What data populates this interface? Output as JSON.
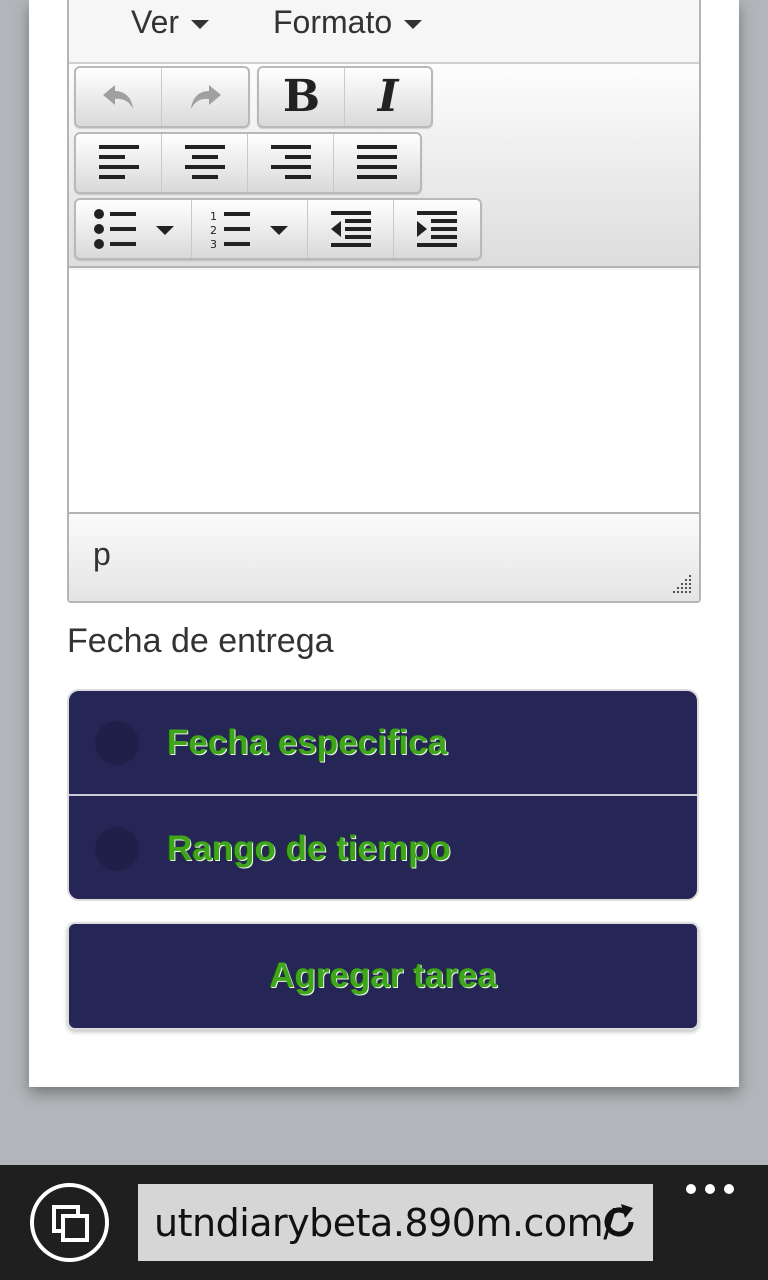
{
  "menubar": {
    "view_label": "Ver",
    "format_label": "Formato"
  },
  "toolbar": {
    "bold_glyph": "B",
    "italic_glyph": "I",
    "icons": [
      "undo-icon",
      "redo-icon",
      "bold-icon",
      "italic-icon",
      "align-left-icon",
      "align-center-icon",
      "align-right-icon",
      "align-justify-icon",
      "bullet-list-icon",
      "numbered-list-icon",
      "outdent-icon",
      "indent-icon"
    ]
  },
  "statusbar": {
    "path": "p"
  },
  "form": {
    "due_date_label": "Fecha de entrega",
    "options": [
      {
        "label": "Fecha especifica"
      },
      {
        "label": "Rango de tiempo"
      }
    ],
    "submit_label": "Agregar tarea"
  },
  "browser": {
    "url": "utndiarybeta.890m.com/"
  },
  "colors": {
    "button_bg": "#252655",
    "button_text": "#3fa51c",
    "appbar_bg": "#1f1f1f",
    "page_bg": "#b2b5b9"
  }
}
